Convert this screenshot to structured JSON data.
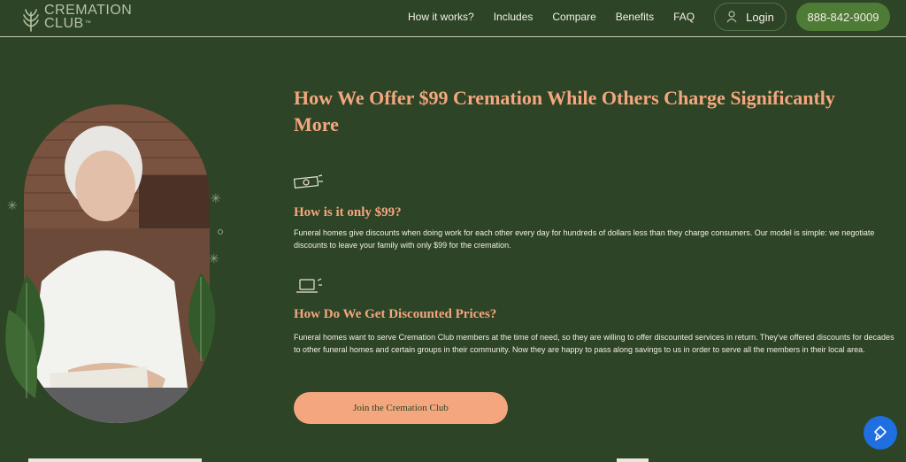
{
  "brand": {
    "name_line1": "CREMATION",
    "name_line2": "CLUB",
    "tm": "™"
  },
  "nav": {
    "items": [
      "How it works?",
      "Includes",
      "Compare",
      "Benefits",
      "FAQ"
    ],
    "login": "Login",
    "phone": "888-842-9009"
  },
  "hero": {
    "title": "How We Offer $99 Cremation While Others Charge Significantly More"
  },
  "sections": [
    {
      "icon": "money-icon",
      "title": "How is it only $99?",
      "body": "Funeral homes give discounts when doing work for each other every day for hundreds of dollars less than they charge consumers. Our model is simple: we negotiate discounts to leave your family with only $99 for the cremation."
    },
    {
      "icon": "laptop-icon",
      "title": "How Do We Get Discounted Prices?",
      "body": "Funeral homes want to serve Cremation Club members at the time of need, so they are willing to offer discounted services in return. They've offered discounts for decades to other funeral homes and certain groups in their community. Now they are happy to pass along savings to us in order to serve all the members in their local area."
    }
  ],
  "cta": {
    "label": "Join the Cremation Club"
  },
  "colors": {
    "background": "#2d4426",
    "accent": "#f4a77f",
    "phone_button": "#4e7b36",
    "chat_button": "#1f6fe0"
  }
}
